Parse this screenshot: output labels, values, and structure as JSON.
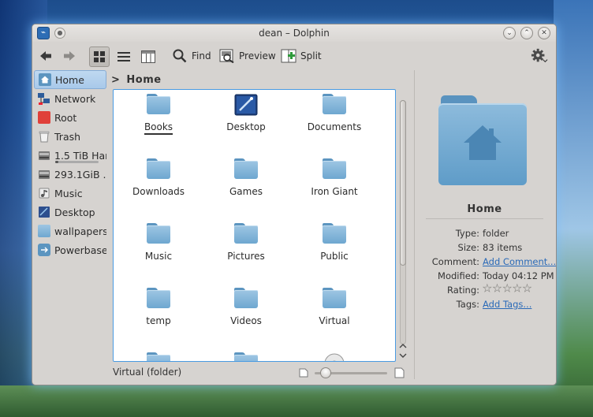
{
  "window": {
    "title": "dean – Dolphin"
  },
  "toolbar": {
    "find_label": "Find",
    "preview_label": "Preview",
    "split_label": "Split"
  },
  "breadcrumb": {
    "separator": ">",
    "current": "Home"
  },
  "places": [
    {
      "label": "Home",
      "icon": "home-icon",
      "active": true
    },
    {
      "label": "Network",
      "icon": "network-icon"
    },
    {
      "label": "Root",
      "icon": "root-folder-icon"
    },
    {
      "label": "Trash",
      "icon": "trash-icon"
    },
    {
      "label": "1.5 TiB Har...",
      "icon": "hard-drive-icon",
      "usage": 0.08
    },
    {
      "label": "293.1GiB ...",
      "icon": "hard-drive-icon"
    },
    {
      "label": "Music",
      "icon": "music-icon"
    },
    {
      "label": "Desktop",
      "icon": "desktop-icon"
    },
    {
      "label": "wallpapers",
      "icon": "folder-icon"
    },
    {
      "label": "Powerbase",
      "icon": "usb-drive-icon"
    }
  ],
  "files": [
    {
      "name": "Books",
      "focused": true
    },
    {
      "name": "Desktop",
      "icon": "desktop-icon"
    },
    {
      "name": "Documents"
    },
    {
      "name": "Downloads"
    },
    {
      "name": "Games"
    },
    {
      "name": "Iron Giant"
    },
    {
      "name": "Music"
    },
    {
      "name": "Pictures"
    },
    {
      "name": "Public"
    },
    {
      "name": "temp"
    },
    {
      "name": "Videos"
    },
    {
      "name": "Virtual"
    }
  ],
  "status": {
    "text": "Virtual (folder)",
    "zoom_level": 0.15
  },
  "info_panel": {
    "title": "Home",
    "type_label": "Type:",
    "type_value": "folder",
    "size_label": "Size:",
    "size_value": "83 items",
    "comment_label": "Comment:",
    "comment_value": "Add Comment...",
    "modified_label": "Modified:",
    "modified_value": "Today 04:12 PM",
    "rating_label": "Rating:",
    "rating_value": 0,
    "tags_label": "Tags:",
    "tags_value": "Add Tags..."
  },
  "colors": {
    "accent": "#4a9be2",
    "folder": "#6ea7d0",
    "link": "#2a6ab8"
  }
}
